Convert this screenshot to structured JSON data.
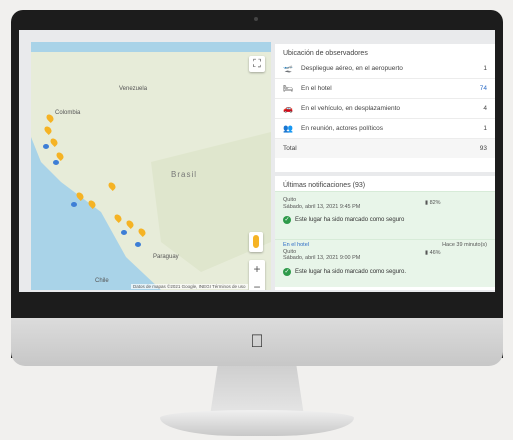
{
  "map": {
    "labels": {
      "venezuela": "Venezuela",
      "colombia": "Colombia",
      "brasil": "Brasil",
      "paraguay": "Paraguay",
      "chile": "Chile"
    },
    "attribution": "Datos de mapas ©2021 Google, INEGI  Términos de uso"
  },
  "observers": {
    "title": "Ubicación de observadores",
    "rows": [
      {
        "icon": "airport-icon",
        "label": "Despliegue aéreo, en el aeropuerto",
        "value": "1"
      },
      {
        "icon": "hotel-icon",
        "label": "En el hotel",
        "value": "74"
      },
      {
        "icon": "car-icon",
        "label": "En el vehículo, en desplazamiento",
        "value": "4"
      },
      {
        "icon": "meeting-icon",
        "label": "En reunión, actores políticos",
        "value": "1"
      }
    ],
    "total_label": "Total",
    "total_value": "93"
  },
  "notifications": {
    "title": "Últimas notificaciones (93)",
    "items": [
      {
        "place": "",
        "ago": "",
        "city": "Quito",
        "date": "Sábado, abril 13, 2021 9:45 PM",
        "battery": "82%",
        "message": "Este lugar ha sido marcado como seguro"
      },
      {
        "place": "En el hotel",
        "ago": "Hace 39 minuto(s)",
        "city": "Quito",
        "date": "Sábado, abril 13, 2021 9:00 PM",
        "battery": "46%",
        "message": "Este lugar ha sido marcado como seguro."
      }
    ]
  }
}
